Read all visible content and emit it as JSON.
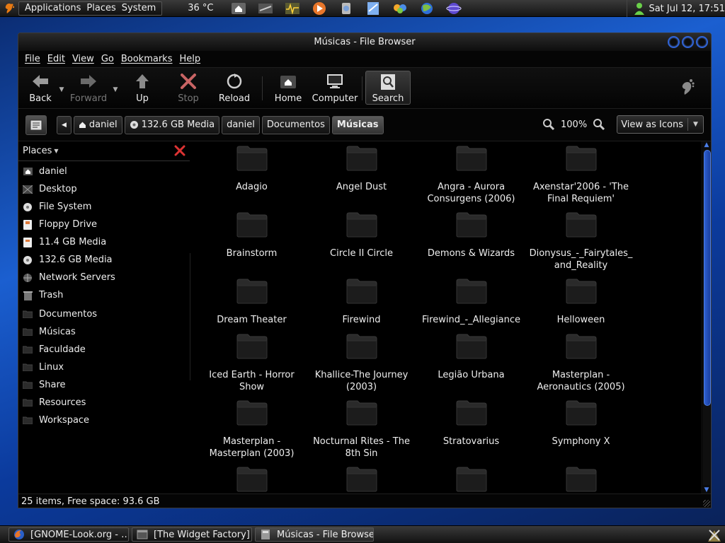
{
  "top_panel": {
    "menus": [
      "Applications",
      "Places",
      "System"
    ],
    "temperature": "36 °C",
    "launchers": [
      "home-folder-icon",
      "terminal-icon",
      "system-monitor-icon",
      "media-player-icon",
      "sound-juicer-icon",
      "text-editor-icon",
      "messenger-icon",
      "web-browser-icon",
      "planet-icon"
    ],
    "clock": "Sat Jul 12, 17:51"
  },
  "window": {
    "title": "Músicas - File Browser",
    "menubar": [
      "File",
      "Edit",
      "View",
      "Go",
      "Bookmarks",
      "Help"
    ],
    "toolbar": {
      "back": "Back",
      "forward": "Forward",
      "up": "Up",
      "stop": "Stop",
      "reload": "Reload",
      "home": "Home",
      "computer": "Computer",
      "search": "Search"
    },
    "breadcrumbs": [
      "daniel",
      "132.6 GB Media",
      "daniel",
      "Documentos",
      "Músicas"
    ],
    "zoom_level": "100%",
    "view_mode": "View as Icons",
    "sidebar": {
      "title": "Places",
      "items": [
        {
          "label": "daniel",
          "icon": "home-icon"
        },
        {
          "label": "Desktop",
          "icon": "desktop-icon"
        },
        {
          "label": "File System",
          "icon": "harddisk-icon"
        },
        {
          "label": "Floppy Drive",
          "icon": "floppy-icon"
        },
        {
          "label": "11.4 GB Media",
          "icon": "drive-icon"
        },
        {
          "label": "132.6 GB Media",
          "icon": "harddisk-icon"
        },
        {
          "label": "Network Servers",
          "icon": "network-icon"
        },
        {
          "label": "Trash",
          "icon": "trash-icon"
        }
      ],
      "bookmarks": [
        {
          "label": "Documentos",
          "icon": "folder-icon"
        },
        {
          "label": "Músicas",
          "icon": "folder-icon"
        },
        {
          "label": "Faculdade",
          "icon": "folder-icon"
        },
        {
          "label": "Linux",
          "icon": "folder-icon"
        },
        {
          "label": "Share",
          "icon": "folder-icon"
        },
        {
          "label": "Resources",
          "icon": "folder-icon"
        },
        {
          "label": "Workspace",
          "icon": "folder-icon"
        }
      ]
    },
    "folders": [
      "Adagio",
      "Angel Dust",
      "Angra - Aurora Consurgens (2006)",
      "Axenstar'2006 - 'The Final Requiem'",
      "Brainstorm",
      "Circle II Circle",
      "Demons & Wizards",
      "Dionysus_-_Fairytales_ and_Reality",
      "Dream Theater",
      "Firewind",
      "Firewind_-_Allegiance",
      "Helloween",
      "Iced Earth - Horror Show",
      "Khallice-The Journey (2003)",
      "Legião Urbana",
      "Masterplan - Aeronautics (2005)",
      "Masterplan - Masterplan (2003)",
      "Nocturnal Rites - The 8th Sin",
      "Stratovarius",
      "Symphony X",
      "",
      "",
      "",
      ""
    ],
    "status": "25 items, Free space: 93.6 GB"
  },
  "taskbar": {
    "tasks": [
      {
        "label": "[GNOME-Look.org - …",
        "icon": "firefox-icon"
      },
      {
        "label": "[The Widget Factory]",
        "icon": "window-icon"
      },
      {
        "label": "Músicas - File Browser",
        "icon": "file-browser-icon"
      }
    ]
  },
  "colors": {
    "accent": "#2f63d6",
    "background": "#000000",
    "text": "#e8e8e8"
  }
}
